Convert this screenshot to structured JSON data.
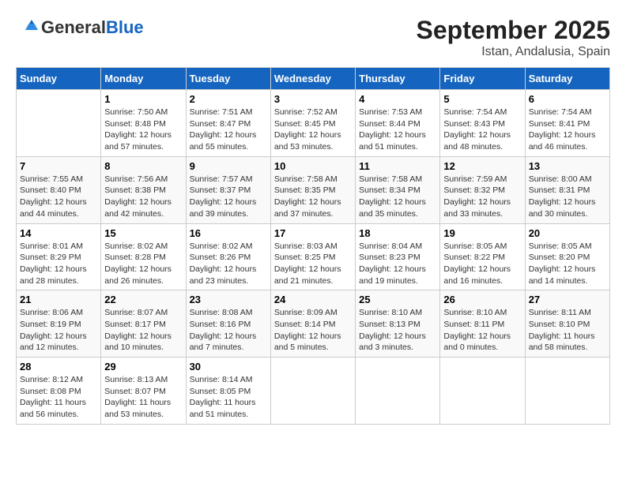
{
  "header": {
    "logo_general": "General",
    "logo_blue": "Blue",
    "title": "September 2025",
    "subtitle": "Istan, Andalusia, Spain"
  },
  "days_of_week": [
    "Sunday",
    "Monday",
    "Tuesday",
    "Wednesday",
    "Thursday",
    "Friday",
    "Saturday"
  ],
  "weeks": [
    [
      {
        "day": "",
        "sunrise": "",
        "sunset": "",
        "daylight": ""
      },
      {
        "day": "1",
        "sunrise": "Sunrise: 7:50 AM",
        "sunset": "Sunset: 8:48 PM",
        "daylight": "Daylight: 12 hours and 57 minutes."
      },
      {
        "day": "2",
        "sunrise": "Sunrise: 7:51 AM",
        "sunset": "Sunset: 8:47 PM",
        "daylight": "Daylight: 12 hours and 55 minutes."
      },
      {
        "day": "3",
        "sunrise": "Sunrise: 7:52 AM",
        "sunset": "Sunset: 8:45 PM",
        "daylight": "Daylight: 12 hours and 53 minutes."
      },
      {
        "day": "4",
        "sunrise": "Sunrise: 7:53 AM",
        "sunset": "Sunset: 8:44 PM",
        "daylight": "Daylight: 12 hours and 51 minutes."
      },
      {
        "day": "5",
        "sunrise": "Sunrise: 7:54 AM",
        "sunset": "Sunset: 8:43 PM",
        "daylight": "Daylight: 12 hours and 48 minutes."
      },
      {
        "day": "6",
        "sunrise": "Sunrise: 7:54 AM",
        "sunset": "Sunset: 8:41 PM",
        "daylight": "Daylight: 12 hours and 46 minutes."
      }
    ],
    [
      {
        "day": "7",
        "sunrise": "Sunrise: 7:55 AM",
        "sunset": "Sunset: 8:40 PM",
        "daylight": "Daylight: 12 hours and 44 minutes."
      },
      {
        "day": "8",
        "sunrise": "Sunrise: 7:56 AM",
        "sunset": "Sunset: 8:38 PM",
        "daylight": "Daylight: 12 hours and 42 minutes."
      },
      {
        "day": "9",
        "sunrise": "Sunrise: 7:57 AM",
        "sunset": "Sunset: 8:37 PM",
        "daylight": "Daylight: 12 hours and 39 minutes."
      },
      {
        "day": "10",
        "sunrise": "Sunrise: 7:58 AM",
        "sunset": "Sunset: 8:35 PM",
        "daylight": "Daylight: 12 hours and 37 minutes."
      },
      {
        "day": "11",
        "sunrise": "Sunrise: 7:58 AM",
        "sunset": "Sunset: 8:34 PM",
        "daylight": "Daylight: 12 hours and 35 minutes."
      },
      {
        "day": "12",
        "sunrise": "Sunrise: 7:59 AM",
        "sunset": "Sunset: 8:32 PM",
        "daylight": "Daylight: 12 hours and 33 minutes."
      },
      {
        "day": "13",
        "sunrise": "Sunrise: 8:00 AM",
        "sunset": "Sunset: 8:31 PM",
        "daylight": "Daylight: 12 hours and 30 minutes."
      }
    ],
    [
      {
        "day": "14",
        "sunrise": "Sunrise: 8:01 AM",
        "sunset": "Sunset: 8:29 PM",
        "daylight": "Daylight: 12 hours and 28 minutes."
      },
      {
        "day": "15",
        "sunrise": "Sunrise: 8:02 AM",
        "sunset": "Sunset: 8:28 PM",
        "daylight": "Daylight: 12 hours and 26 minutes."
      },
      {
        "day": "16",
        "sunrise": "Sunrise: 8:02 AM",
        "sunset": "Sunset: 8:26 PM",
        "daylight": "Daylight: 12 hours and 23 minutes."
      },
      {
        "day": "17",
        "sunrise": "Sunrise: 8:03 AM",
        "sunset": "Sunset: 8:25 PM",
        "daylight": "Daylight: 12 hours and 21 minutes."
      },
      {
        "day": "18",
        "sunrise": "Sunrise: 8:04 AM",
        "sunset": "Sunset: 8:23 PM",
        "daylight": "Daylight: 12 hours and 19 minutes."
      },
      {
        "day": "19",
        "sunrise": "Sunrise: 8:05 AM",
        "sunset": "Sunset: 8:22 PM",
        "daylight": "Daylight: 12 hours and 16 minutes."
      },
      {
        "day": "20",
        "sunrise": "Sunrise: 8:05 AM",
        "sunset": "Sunset: 8:20 PM",
        "daylight": "Daylight: 12 hours and 14 minutes."
      }
    ],
    [
      {
        "day": "21",
        "sunrise": "Sunrise: 8:06 AM",
        "sunset": "Sunset: 8:19 PM",
        "daylight": "Daylight: 12 hours and 12 minutes."
      },
      {
        "day": "22",
        "sunrise": "Sunrise: 8:07 AM",
        "sunset": "Sunset: 8:17 PM",
        "daylight": "Daylight: 12 hours and 10 minutes."
      },
      {
        "day": "23",
        "sunrise": "Sunrise: 8:08 AM",
        "sunset": "Sunset: 8:16 PM",
        "daylight": "Daylight: 12 hours and 7 minutes."
      },
      {
        "day": "24",
        "sunrise": "Sunrise: 8:09 AM",
        "sunset": "Sunset: 8:14 PM",
        "daylight": "Daylight: 12 hours and 5 minutes."
      },
      {
        "day": "25",
        "sunrise": "Sunrise: 8:10 AM",
        "sunset": "Sunset: 8:13 PM",
        "daylight": "Daylight: 12 hours and 3 minutes."
      },
      {
        "day": "26",
        "sunrise": "Sunrise: 8:10 AM",
        "sunset": "Sunset: 8:11 PM",
        "daylight": "Daylight: 12 hours and 0 minutes."
      },
      {
        "day": "27",
        "sunrise": "Sunrise: 8:11 AM",
        "sunset": "Sunset: 8:10 PM",
        "daylight": "Daylight: 11 hours and 58 minutes."
      }
    ],
    [
      {
        "day": "28",
        "sunrise": "Sunrise: 8:12 AM",
        "sunset": "Sunset: 8:08 PM",
        "daylight": "Daylight: 11 hours and 56 minutes."
      },
      {
        "day": "29",
        "sunrise": "Sunrise: 8:13 AM",
        "sunset": "Sunset: 8:07 PM",
        "daylight": "Daylight: 11 hours and 53 minutes."
      },
      {
        "day": "30",
        "sunrise": "Sunrise: 8:14 AM",
        "sunset": "Sunset: 8:05 PM",
        "daylight": "Daylight: 11 hours and 51 minutes."
      },
      {
        "day": "",
        "sunrise": "",
        "sunset": "",
        "daylight": ""
      },
      {
        "day": "",
        "sunrise": "",
        "sunset": "",
        "daylight": ""
      },
      {
        "day": "",
        "sunrise": "",
        "sunset": "",
        "daylight": ""
      },
      {
        "day": "",
        "sunrise": "",
        "sunset": "",
        "daylight": ""
      }
    ]
  ]
}
